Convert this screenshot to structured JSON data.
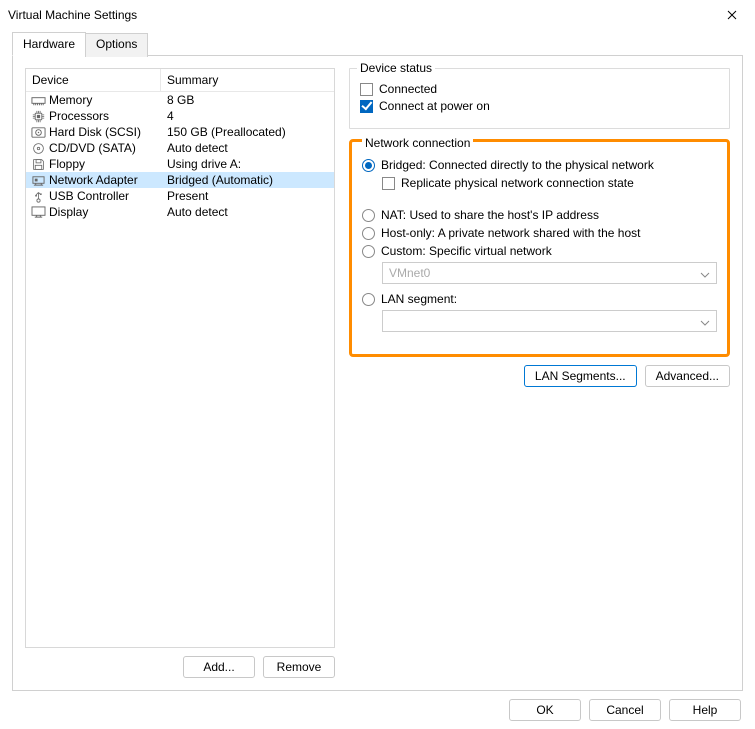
{
  "window": {
    "title": "Virtual Machine Settings"
  },
  "tabs": {
    "hardware": "Hardware",
    "options": "Options"
  },
  "table": {
    "head_device": "Device",
    "head_summary": "Summary",
    "rows": [
      {
        "device": "Memory",
        "summary": "8 GB",
        "icon": "memory"
      },
      {
        "device": "Processors",
        "summary": "4",
        "icon": "cpu"
      },
      {
        "device": "Hard Disk (SCSI)",
        "summary": "150 GB (Preallocated)",
        "icon": "hdd"
      },
      {
        "device": "CD/DVD (SATA)",
        "summary": "Auto detect",
        "icon": "cd"
      },
      {
        "device": "Floppy",
        "summary": "Using drive A:",
        "icon": "floppy"
      },
      {
        "device": "Network Adapter",
        "summary": "Bridged (Automatic)",
        "icon": "net",
        "selected": true
      },
      {
        "device": "USB Controller",
        "summary": "Present",
        "icon": "usb"
      },
      {
        "device": "Display",
        "summary": "Auto detect",
        "icon": "display"
      }
    ]
  },
  "left_buttons": {
    "add": "Add...",
    "remove": "Remove"
  },
  "device_status": {
    "legend": "Device status",
    "connected": "Connected",
    "connect_power_on": "Connect at power on"
  },
  "network": {
    "legend": "Network connection",
    "bridged": "Bridged: Connected directly to the physical network",
    "replicate": "Replicate physical network connection state",
    "nat": "NAT: Used to share the host's IP address",
    "hostonly": "Host-only: A private network shared with the host",
    "custom": "Custom: Specific virtual network",
    "custom_value": "VMnet0",
    "lanseg": "LAN segment:",
    "lanseg_value": ""
  },
  "right_buttons": {
    "lan_segments": "LAN Segments...",
    "advanced": "Advanced..."
  },
  "footer": {
    "ok": "OK",
    "cancel": "Cancel",
    "help": "Help"
  }
}
